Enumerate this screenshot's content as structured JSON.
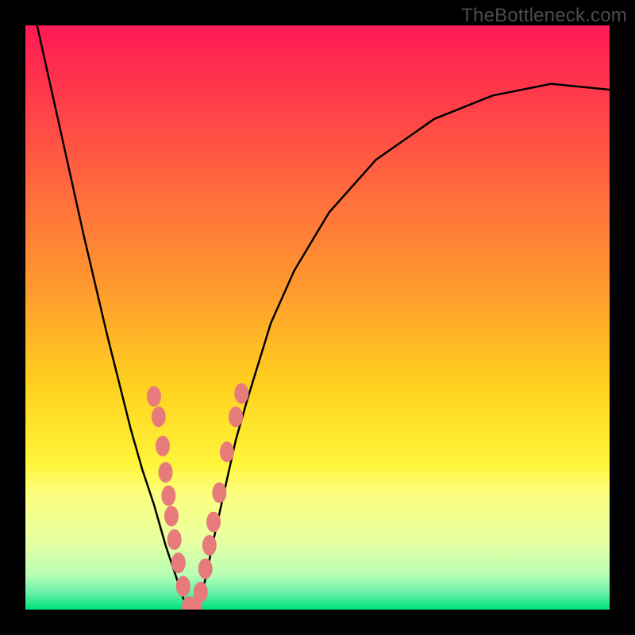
{
  "watermark": "TheBottleneck.com",
  "chart_data": {
    "type": "line",
    "title": "",
    "xlabel": "",
    "ylabel": "",
    "xlim": [
      0,
      100
    ],
    "ylim": [
      0,
      100
    ],
    "grid": false,
    "legend": false,
    "background": {
      "gradient_stops": [
        {
          "pos": 0.0,
          "color": "#ff1a55"
        },
        {
          "pos": 0.12,
          "color": "#ff3a4a"
        },
        {
          "pos": 0.28,
          "color": "#ff6a3d"
        },
        {
          "pos": 0.45,
          "color": "#ff9a2e"
        },
        {
          "pos": 0.62,
          "color": "#ffd21e"
        },
        {
          "pos": 0.75,
          "color": "#fff53a"
        },
        {
          "pos": 0.8,
          "color": "#fcff7c"
        },
        {
          "pos": 0.88,
          "color": "#e9ffa0"
        },
        {
          "pos": 0.94,
          "color": "#b9ffb4"
        },
        {
          "pos": 0.97,
          "color": "#6cf2a9"
        },
        {
          "pos": 1.0,
          "color": "#00e27a"
        }
      ]
    },
    "series": [
      {
        "name": "bottleneck-curve",
        "color": "#000000",
        "x": [
          2,
          6,
          10,
          14,
          18,
          20,
          22,
          24,
          25,
          26,
          27,
          28,
          29,
          30,
          31,
          32,
          34,
          36,
          38,
          42,
          46,
          52,
          60,
          70,
          80,
          90,
          100
        ],
        "y": [
          100,
          82,
          64,
          47,
          31,
          24,
          18,
          11,
          8,
          5,
          2,
          0,
          0,
          2,
          6,
          11,
          20,
          29,
          36,
          49,
          58,
          68,
          77,
          84,
          88,
          90,
          89
        ]
      }
    ],
    "markers": {
      "name": "highlighted-points",
      "color": "#e77b7b",
      "points": [
        {
          "x": 22.0,
          "y": 36.5
        },
        {
          "x": 22.8,
          "y": 33.0
        },
        {
          "x": 23.5,
          "y": 28.0
        },
        {
          "x": 24.0,
          "y": 23.5
        },
        {
          "x": 24.5,
          "y": 19.5
        },
        {
          "x": 25.0,
          "y": 16.0
        },
        {
          "x": 25.5,
          "y": 12.0
        },
        {
          "x": 26.2,
          "y": 8.0
        },
        {
          "x": 27.0,
          "y": 4.0
        },
        {
          "x": 28.0,
          "y": 0.5
        },
        {
          "x": 29.0,
          "y": 0.5
        },
        {
          "x": 30.0,
          "y": 3.0
        },
        {
          "x": 30.8,
          "y": 7.0
        },
        {
          "x": 31.5,
          "y": 11.0
        },
        {
          "x": 32.2,
          "y": 15.0
        },
        {
          "x": 33.2,
          "y": 20.0
        },
        {
          "x": 34.5,
          "y": 27.0
        },
        {
          "x": 36.0,
          "y": 33.0
        },
        {
          "x": 37.0,
          "y": 37.0
        }
      ]
    }
  }
}
